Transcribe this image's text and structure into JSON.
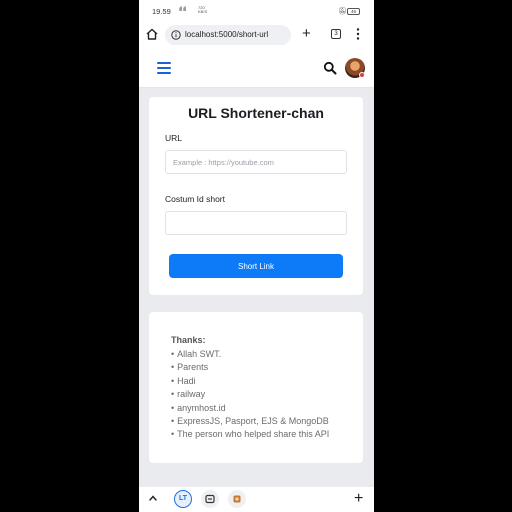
{
  "status_bar": {
    "time": "19.59",
    "signal": "ıll ıll",
    "speed_value": "720",
    "speed_unit": "KB/S",
    "battery": "46"
  },
  "browser": {
    "url": "localhost:5000/short-url",
    "tab_count": "3"
  },
  "form": {
    "title": "URL Shortener-chan",
    "url_label": "URL",
    "url_placeholder": "Example : https://youtube.com",
    "url_value": "",
    "custom_label": "Costum Id short",
    "custom_value": "",
    "submit_label": "Short Link"
  },
  "thanks": {
    "title": "Thanks:",
    "items": [
      "Allah SWT.",
      "Parents",
      "Hadi",
      "railway",
      "anymhost.id",
      "ExpressJS, Pasport, EJS & MongoDB",
      "The person who helped share this API"
    ]
  },
  "bottom_nav": {
    "active_tab_glyph": "LT"
  },
  "colors": {
    "accent": "#0d7bf7",
    "menu": "#1f5fd6",
    "page_bg": "#e9ebee"
  }
}
